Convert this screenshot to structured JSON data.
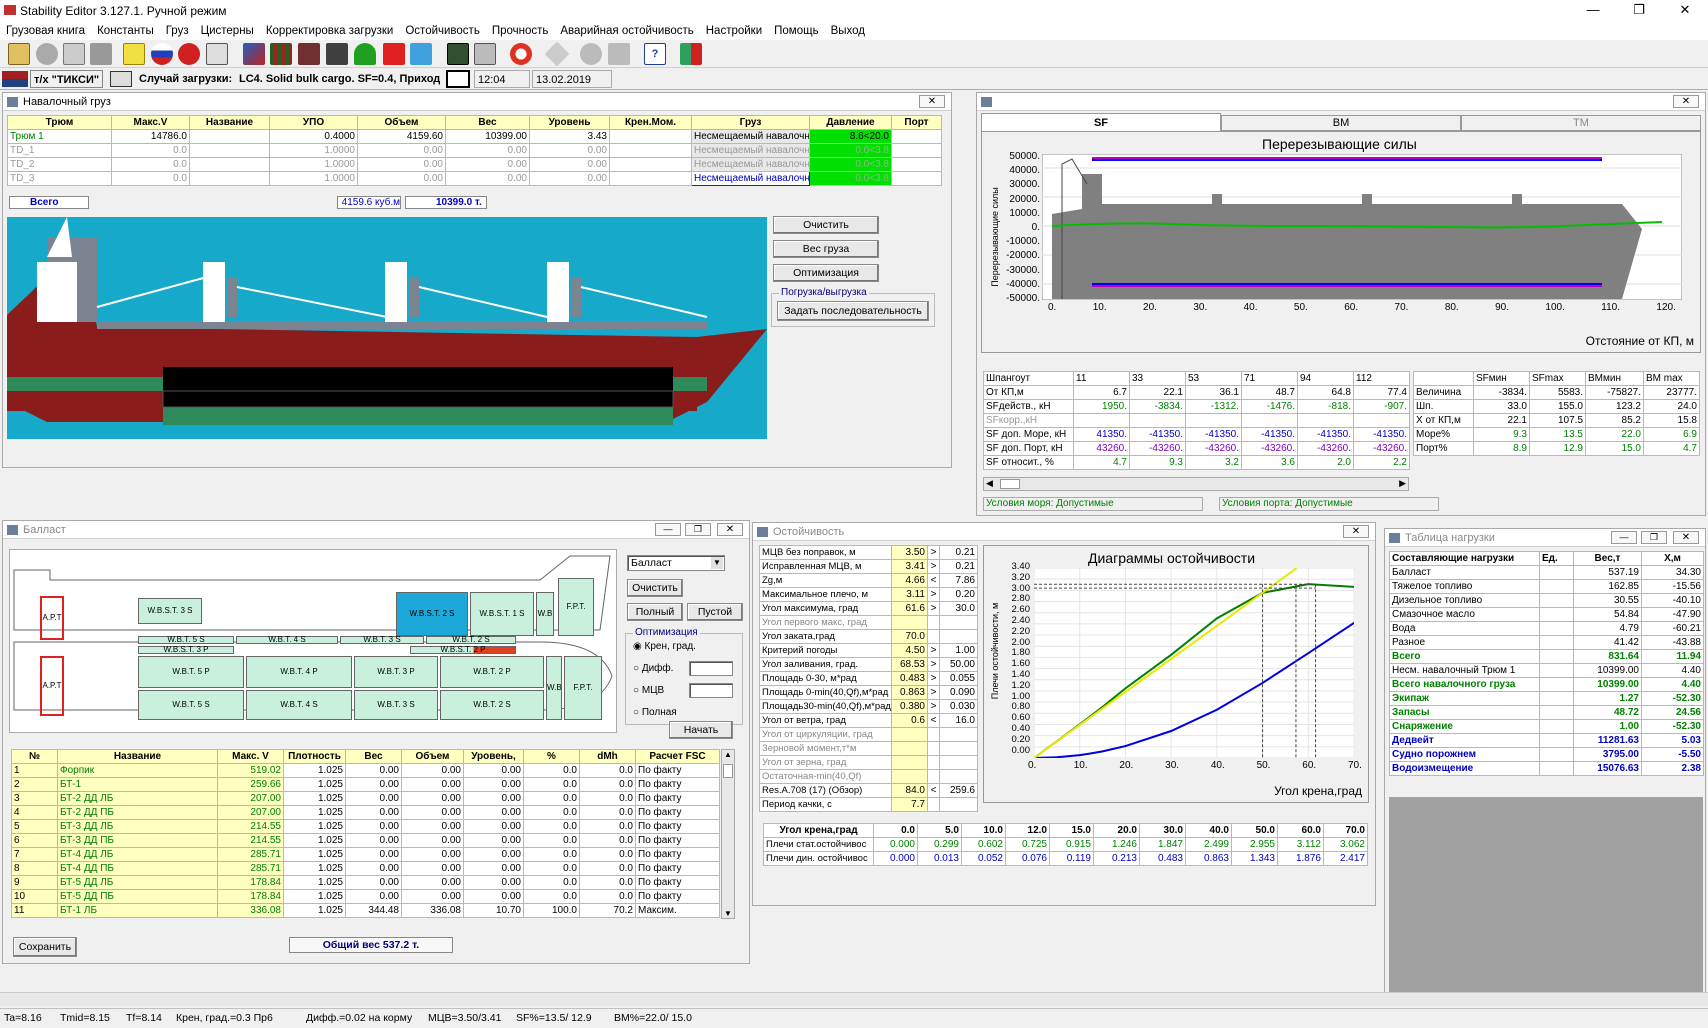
{
  "window": {
    "title": "Stability Editor 3.127.1.   Ручной режим"
  },
  "menu": [
    "Грузовая книга",
    "Константы",
    "Груз",
    "Цистерны",
    "Корректировка загрузки",
    "Остойчивость",
    "Прочность",
    "Аварийная остойчивость",
    "Настройки",
    "Помощь",
    "Выход"
  ],
  "info": {
    "ship": "т/х \"ТИКСИ\"",
    "case_label": "Случай загрузки:",
    "case_value": "LC4. Solid bulk  cargo. SF=0.4, Приход",
    "time": "12:04",
    "date": "13.02.2019"
  },
  "bulk": {
    "title": "Навалочный груз",
    "headers": [
      "Трюм",
      "Макс.V",
      "Название",
      "УПО",
      "Объем",
      "Вес",
      "Уровень",
      "Крен.Мом.",
      "Груз",
      "Давление",
      "Порт"
    ],
    "rows": [
      [
        "Трюм 1",
        "14786.0",
        "",
        "0.4000",
        "4159.60",
        "10399.00",
        "3.43",
        "",
        "Несмещаемый навалочн",
        "8.6<20.0",
        ""
      ],
      [
        "ТD_1",
        "0.0",
        "",
        "1.0000",
        "0.00",
        "0.00",
        "0.00",
        "",
        "Несмещаемый навалочн",
        "0.0<3.8",
        ""
      ],
      [
        "ТD_2",
        "0.0",
        "",
        "1.0000",
        "0.00",
        "0.00",
        "0.00",
        "",
        "Несмещаемый навалочн",
        "0.0<3.8",
        ""
      ],
      [
        "ТD_3",
        "0.0",
        "",
        "1.0000",
        "0.00",
        "0.00",
        "0.00",
        "",
        "Несмещаемый навалочн",
        "0.0<3.8",
        ""
      ]
    ],
    "total_label": "Всего",
    "total_volume": "4159.6  куб.м",
    "total_weight": "10399.0 т.",
    "buttons": {
      "clear": "Очистить",
      "weight": "Вес груза",
      "opt": "Оптимизация",
      "group": "Погрузка/выгрузка",
      "seq": "Задать последовательность"
    }
  },
  "sf": {
    "tabs": [
      "SF",
      "BM",
      "TM"
    ],
    "chart_title": "Перерезывающие силы",
    "ylabel": "Перерезывающие силы",
    "xlabel": "Отстояние от КП, м",
    "yticks": [
      "50000.",
      "40000.",
      "30000.",
      "20000.",
      "10000.",
      "0.",
      "-10000.",
      "-20000.",
      "-30000.",
      "-40000.",
      "-50000."
    ],
    "xticks": [
      "0.",
      "10.",
      "20.",
      "30.",
      "40.",
      "50.",
      "60.",
      "70.",
      "80.",
      "90.",
      "100.",
      "110.",
      "120."
    ],
    "table": [
      [
        "Шпангоут",
        "11",
        "33",
        "53",
        "71",
        "94",
        "112"
      ],
      [
        "От КП,м",
        "6.7",
        "22.1",
        "36.1",
        "48.7",
        "64.8",
        "77.4"
      ],
      [
        "SFдейств., кН",
        "1950.",
        "-3834.",
        "-1312.",
        "-1476.",
        "-818.",
        "-907."
      ],
      [
        "SFкорр.,кН",
        "",
        "",
        "",
        "",
        "",
        ""
      ],
      [
        "SF доп. Море, кН",
        "41350.",
        "-41350.",
        "-41350.",
        "-41350.",
        "-41350.",
        "-41350."
      ],
      [
        "SF доп. Порт, кН",
        "43260.",
        "-43260.",
        "-43260.",
        "-43260.",
        "-43260.",
        "-43260."
      ],
      [
        "SF относит., %",
        "4.7",
        "9.3",
        "3.2",
        "3.6",
        "2.0",
        "2.2"
      ]
    ],
    "summary_headers": [
      "",
      "SFмин",
      "SFmax",
      "BMмин",
      "BM max"
    ],
    "summary": [
      [
        "Величина",
        "-3834.",
        "5583.",
        "-75827.",
        "23777."
      ],
      [
        "Шп.",
        "33.0",
        "155.0",
        "123.2",
        "24.0"
      ],
      [
        "X от КП,м",
        "22.1",
        "107.5",
        "85.2",
        "15.8"
      ],
      [
        "Море%",
        "9.3",
        "13.5",
        "22.0",
        "6.9"
      ],
      [
        "Порт%",
        "8.9",
        "12.9",
        "15.0",
        "4.7"
      ]
    ],
    "sea_cond": "Условия моря:  Допустимые",
    "port_cond": "Условия порта:  Допустимые"
  },
  "ballast": {
    "title": "Балласт",
    "select": "Балласт",
    "buttons": {
      "clear": "Очистить",
      "full": "Полный",
      "empty": "Пустой",
      "start": "Начать",
      "save": "Сохранить"
    },
    "opt_label": "Оптимизация",
    "radios": [
      "Крен, град.",
      "Дифф.",
      "МЦВ",
      "Полная"
    ],
    "tanks": {
      "apt": "A.P.T",
      "fpt": "F.P.T.",
      "wb": "W.B",
      "wbst3s": "W.B.S.T. 3 S",
      "wbst2s": "W.B.S.T. 2 S",
      "wbst1s": "W.B.S.T. 1 S",
      "wbt5p": "W.B.T. 5 P",
      "wbt4p": "W.B.T. 4 P",
      "wbt3p": "W.B.T. 3 P",
      "wbt2p": "W.B.T. 2 P",
      "wbt5s": "W.B.T. 5 S",
      "wbt4s": "W.B.T. 4 S",
      "wbt3s": "W.B.T. 3 S",
      "wbt2s": "W.B.T. 2 S",
      "wbst3p": "W.B.S.T. 3 P",
      "wbst2p": "W.B.S.T. 2 P",
      "wbt4s_top": "W.B.T. 4 S",
      "wbt3s_top": "W.B.T. 3 S",
      "wbt2s_top": "W.B.T. 2 S",
      "wbt5s_top": "W.B.T. 5 S"
    },
    "headers": [
      "№",
      "Название",
      "Макс. V",
      "Плотность",
      "Вес",
      "Объем",
      "Уровень,",
      "%",
      "dMh",
      "Расчет FSC"
    ],
    "rows": [
      [
        "1",
        "Форпик",
        "519.02",
        "1.025",
        "0.00",
        "0.00",
        "0.00",
        "0.0",
        "0.0",
        "По факту"
      ],
      [
        "2",
        "БТ-1",
        "259.66",
        "1.025",
        "0.00",
        "0.00",
        "0.00",
        "0.0",
        "0.0",
        "По факту"
      ],
      [
        "3",
        "БТ-2 ДД ЛБ",
        "207.00",
        "1.025",
        "0.00",
        "0.00",
        "0.00",
        "0.0",
        "0.0",
        "По факту"
      ],
      [
        "4",
        "БТ-2 ДД ПБ",
        "207.00",
        "1.025",
        "0.00",
        "0.00",
        "0.00",
        "0.0",
        "0.0",
        "По факту"
      ],
      [
        "5",
        "БТ-3 ДД ЛБ",
        "214.55",
        "1.025",
        "0.00",
        "0.00",
        "0.00",
        "0.0",
        "0.0",
        "По факту"
      ],
      [
        "6",
        "БТ-3 ДД ПБ",
        "214.55",
        "1.025",
        "0.00",
        "0.00",
        "0.00",
        "0.0",
        "0.0",
        "По факту"
      ],
      [
        "7",
        "БТ-4 ДД ЛБ",
        "285.71",
        "1.025",
        "0.00",
        "0.00",
        "0.00",
        "0.0",
        "0.0",
        "По факту"
      ],
      [
        "8",
        "БТ-4 ДД ПБ",
        "285.71",
        "1.025",
        "0.00",
        "0.00",
        "0.00",
        "0.0",
        "0.0",
        "По факту"
      ],
      [
        "9",
        "БТ-5 ДД ЛБ",
        "178.84",
        "1.025",
        "0.00",
        "0.00",
        "0.00",
        "0.0",
        "0.0",
        "По факту"
      ],
      [
        "10",
        "БТ-5 ДД ПБ",
        "178.84",
        "1.025",
        "0.00",
        "0.00",
        "0.00",
        "0.0",
        "0.0",
        "По факту"
      ],
      [
        "11",
        "БТ-1 ЛБ",
        "336.08",
        "1.025",
        "344.48",
        "336.08",
        "10.70",
        "100.0",
        "70.2",
        "Максим."
      ]
    ],
    "total": "Общий вес    537.2 т."
  },
  "stability": {
    "title": "Остойчивость",
    "rows": [
      [
        "МЦВ без поправок, м",
        "3.50",
        ">",
        "0.21"
      ],
      [
        "Исправленная МЦВ, м",
        "3.41",
        ">",
        "0.21"
      ],
      [
        "Zg,м",
        "4.66",
        "<",
        "7.86"
      ],
      [
        "Максимальное плечо, м",
        "3.11",
        ">",
        "0.20"
      ],
      [
        "Угол максимума, град",
        "61.6",
        ">",
        "30.0"
      ],
      [
        "Угол первого макс, град",
        "",
        "",
        ""
      ],
      [
        "Угол заката,град",
        "70.0",
        "",
        ""
      ],
      [
        "Критерий погоды",
        "4.50",
        ">",
        "1.00"
      ],
      [
        "Угол заливания, град.",
        "68.53",
        ">",
        "50.00"
      ],
      [
        "Площадь 0-30, м*рад",
        "0.483",
        ">",
        "0.055"
      ],
      [
        "Площадь 0-min(40,Qf),м*рад",
        "0.863",
        ">",
        "0.090"
      ],
      [
        "Площадь30-min(40,Qf),м*рад",
        "0.380",
        ">",
        "0.030"
      ],
      [
        "Угол от ветра, град",
        "0.6",
        "<",
        "16.0"
      ],
      [
        "Угол от циркуляции, град",
        "",
        "",
        ""
      ],
      [
        "Зерновой момент,т*м",
        "",
        "",
        ""
      ],
      [
        "Угол от зерна, град",
        "",
        "",
        ""
      ],
      [
        "Остаточная-min(40,Qf)",
        "",
        "",
        ""
      ],
      [
        "Res.A.708 (17) (Обзор)",
        "84.0",
        "<",
        "259.6"
      ],
      [
        "Период качки, с",
        "7.7",
        "",
        ""
      ]
    ],
    "chart_title": "Диаграммы остойчивости",
    "ylabel": "Плечи остойчивости, м",
    "xlabel": "Угол крена,град",
    "yticks": [
      "3.40",
      "3.20",
      "3.00",
      "2.80",
      "2.60",
      "2.40",
      "2.20",
      "2.00",
      "1.80",
      "1.60",
      "1.40",
      "1.20",
      "1.00",
      "0.80",
      "0.60",
      "0.40",
      "0.20",
      "0.00"
    ],
    "xticks": [
      "0.",
      "10.",
      "20.",
      "30.",
      "40.",
      "50.",
      "60.",
      "70."
    ],
    "arm_headers": [
      "Угол крена,град",
      "0.0",
      "5.0",
      "10.0",
      "12.0",
      "15.0",
      "20.0",
      "30.0",
      "40.0",
      "50.0",
      "60.0",
      "70.0"
    ],
    "arm_stat": [
      "Плечи стат.остойчивос",
      "0.000",
      "0.299",
      "0.602",
      "0.725",
      "0.915",
      "1.246",
      "1.847",
      "2.499",
      "2.955",
      "3.112",
      "3.062"
    ],
    "arm_dyn": [
      "Плечи дин. остойчивос",
      "0.000",
      "0.013",
      "0.052",
      "0.076",
      "0.119",
      "0.213",
      "0.483",
      "0.863",
      "1.343",
      "1.876",
      "2.417"
    ]
  },
  "chart_data": {
    "type": "line",
    "title": "Диаграммы остойчивости",
    "xlabel": "Угол крена,град",
    "ylabel": "Плечи остойчивости, м",
    "xlim": [
      0,
      70
    ],
    "ylim": [
      0,
      3.4
    ],
    "x": [
      0,
      5,
      10,
      12,
      15,
      20,
      30,
      40,
      50,
      60,
      70
    ],
    "series": [
      {
        "name": "Плечи стат.остойчивос",
        "values": [
          0,
          0.299,
          0.602,
          0.725,
          0.915,
          1.246,
          1.847,
          2.499,
          2.955,
          3.112,
          3.062
        ]
      },
      {
        "name": "Плечи дин. остойчивос",
        "values": [
          0,
          0.013,
          0.052,
          0.076,
          0.119,
          0.213,
          0.483,
          0.863,
          1.343,
          1.876,
          2.417
        ]
      }
    ]
  },
  "load": {
    "title": "Таблица нагрузки",
    "headers": [
      "Составляющие нагрузки",
      "Ед.",
      "Вес,т",
      "X,м"
    ],
    "rows": [
      [
        "Балласт",
        "",
        "537.19",
        "34.30",
        ""
      ],
      [
        "Тяжелое топливо",
        "",
        "162.85",
        "-15.56",
        ""
      ],
      [
        "Дизельное топливо",
        "",
        "30.55",
        "-40.10",
        ""
      ],
      [
        "Смазочное масло",
        "",
        "54.84",
        "-47.90",
        ""
      ],
      [
        "Вода",
        "",
        "4.79",
        "-60.21",
        ""
      ],
      [
        "Разное",
        "",
        "41.42",
        "-43.88",
        ""
      ],
      [
        "Всего",
        "",
        "831.64",
        "11.94",
        "g"
      ],
      [
        "Несм. навалочный  Трюм 1",
        "",
        "10399.00",
        "4.40",
        ""
      ],
      [
        "Всего навалочного груза",
        "",
        "10399.00",
        "4.40",
        "g"
      ],
      [
        "Экипаж",
        "",
        "1.27",
        "-52.30",
        "g"
      ],
      [
        "Запасы",
        "",
        "48.72",
        "24.56",
        "g"
      ],
      [
        "Снаряжение",
        "",
        "1.00",
        "-52.30",
        "g"
      ],
      [
        "Дедвейт",
        "",
        "11281.63",
        "5.03",
        "b"
      ],
      [
        "Судно порожнем",
        "",
        "3795.00",
        "-5.50",
        "b"
      ],
      [
        "Водоизмещение",
        "",
        "15076.63",
        "2.38",
        "b"
      ]
    ]
  },
  "status": {
    "ta": "Ta=8.16",
    "tmid": "Tmid=8.15",
    "tf": "Tf=8.14",
    "heel": "Крен, град.=0.3  Пр6",
    "trim": "Дифф.=0.02 на корму",
    "gm": "МЦВ=3.50/3.41",
    "sf": "SF%=13.5/ 12.9",
    "bm": "BM%=22.0/ 15.0"
  }
}
